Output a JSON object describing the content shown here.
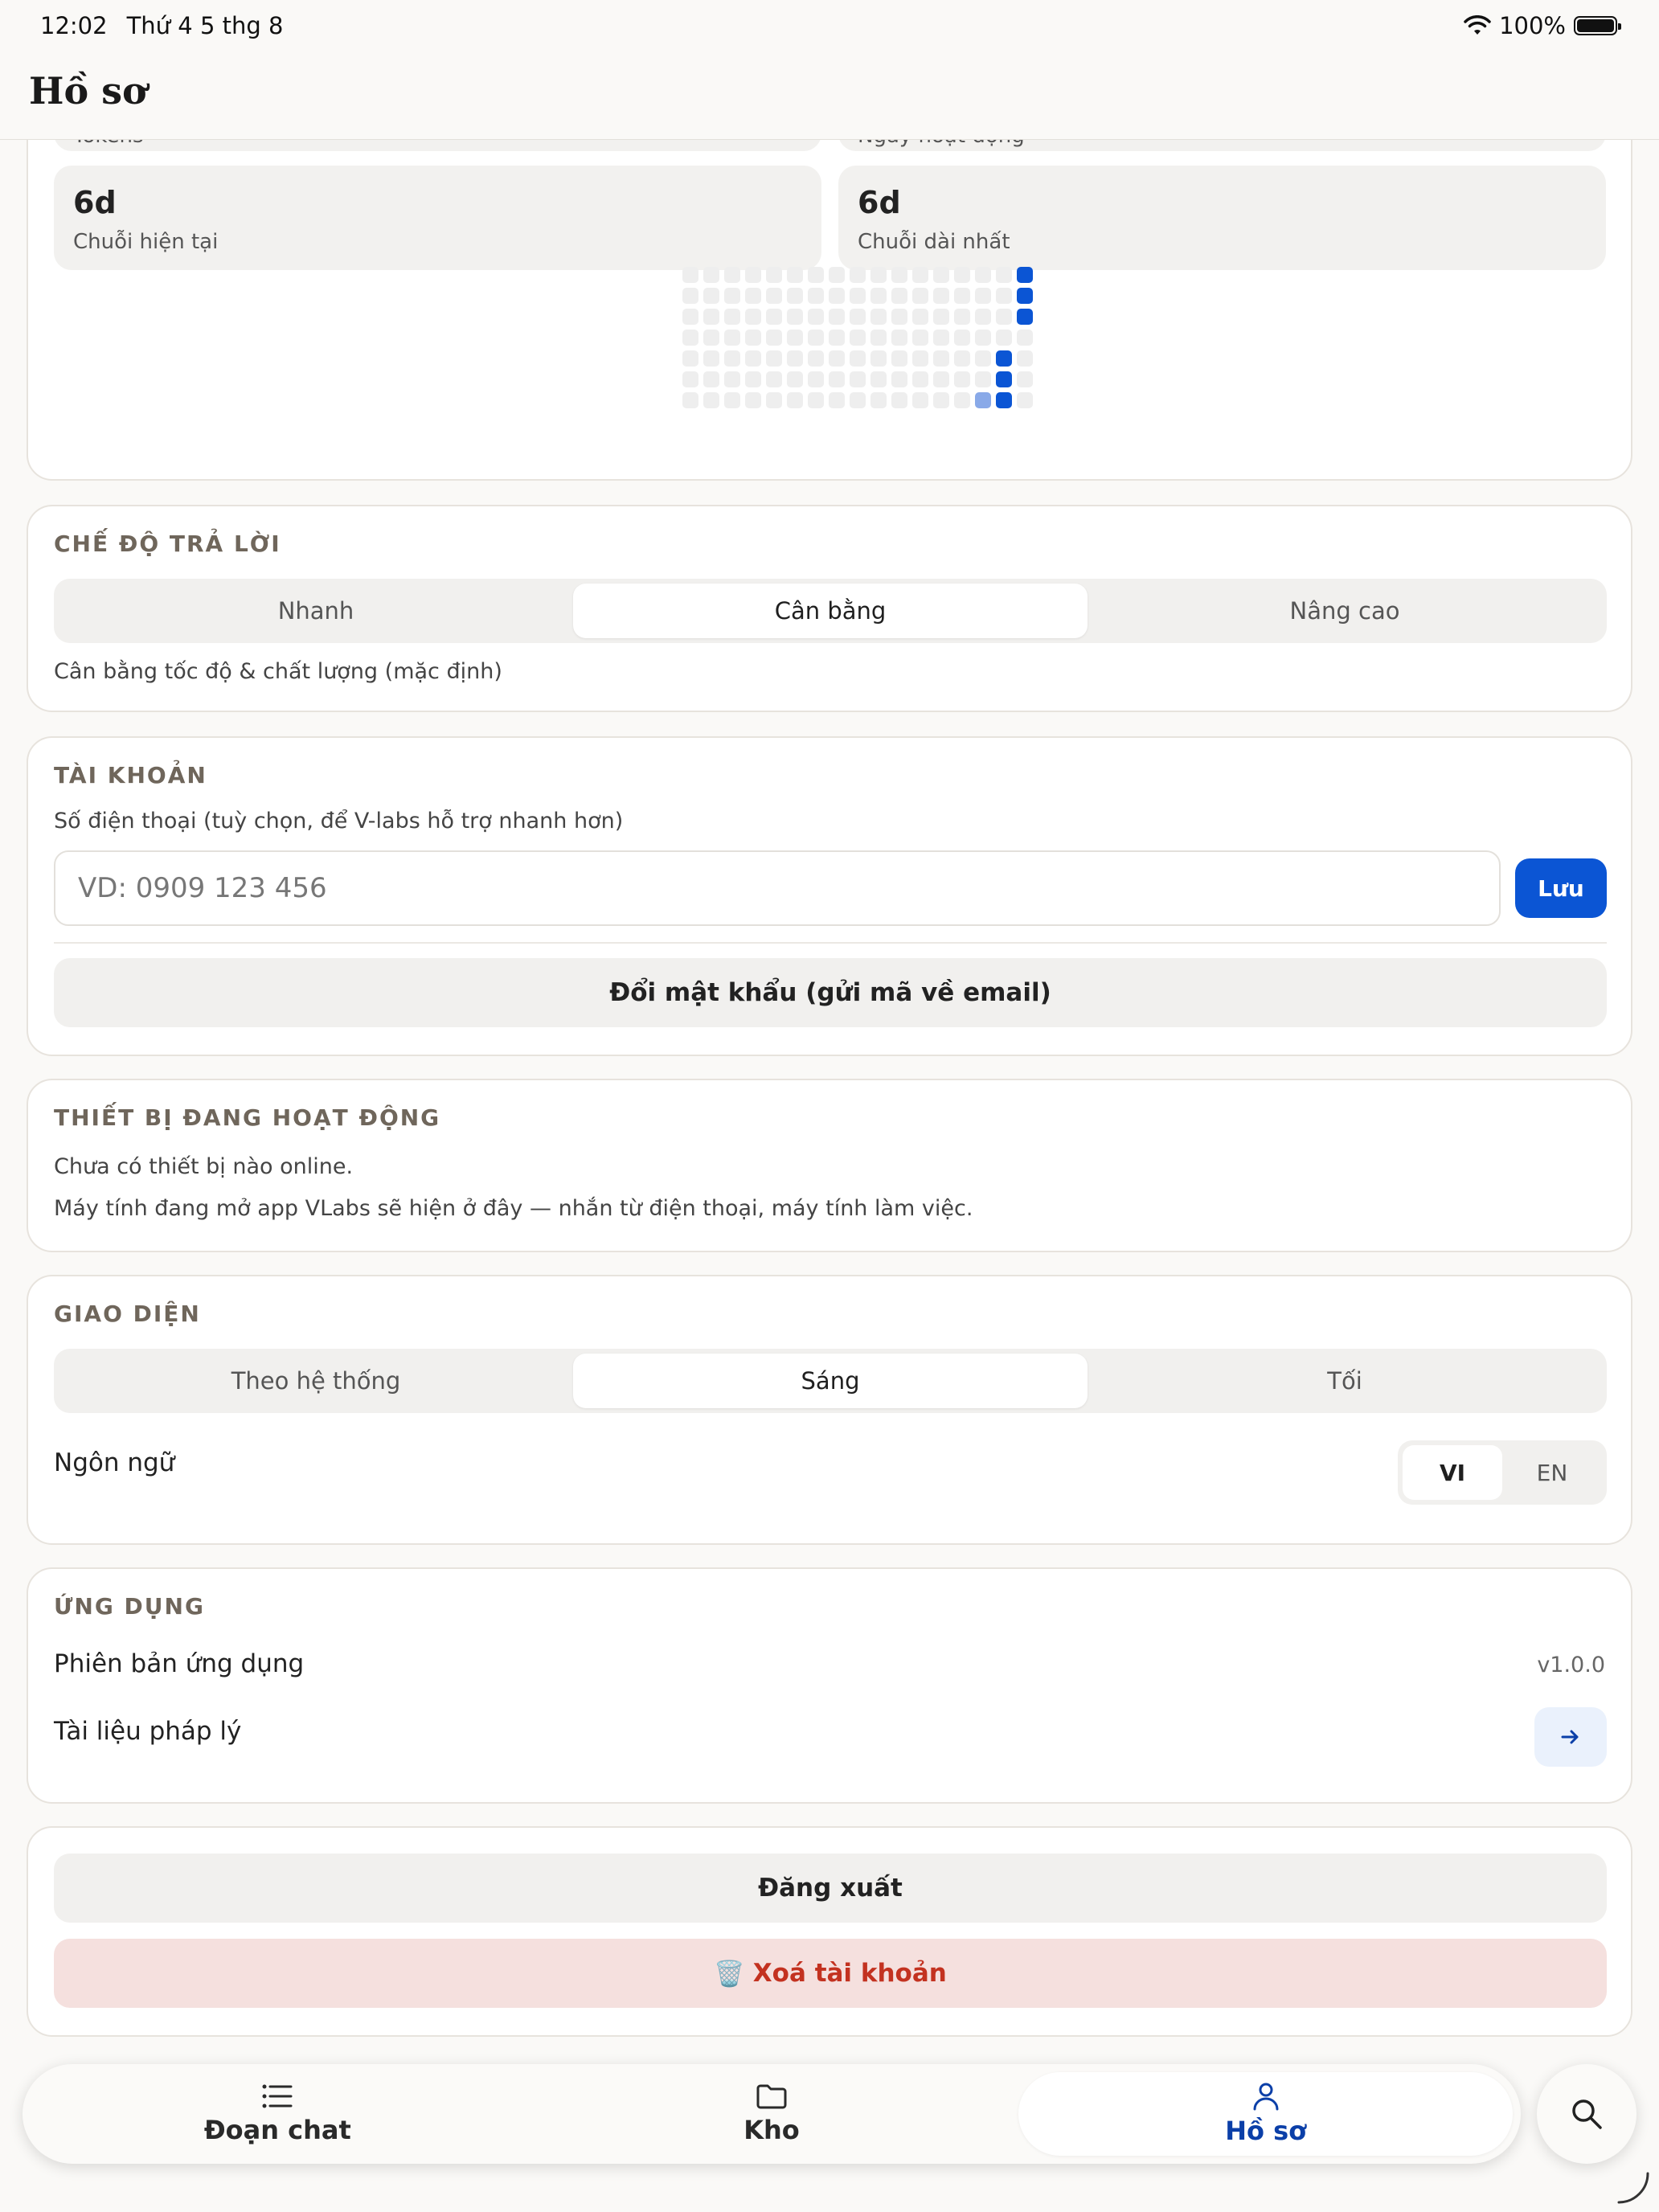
{
  "status": {
    "time": "12:02",
    "date": "Thứ 4 5 thg 8",
    "battery": "100%"
  },
  "header": {
    "title": "Hồ sơ"
  },
  "stats": {
    "top_left_label": "Tokens",
    "top_right_label": "Ngày hoạt động",
    "current_streak_value": "6d",
    "current_streak_label": "Chuỗi hiện tại",
    "longest_streak_value": "6d",
    "longest_streak_label": "Chuỗi dài nhất"
  },
  "response_mode": {
    "title": "CHẾ ĐỘ TRẢ LỜI",
    "options": [
      "Nhanh",
      "Cân bằng",
      "Nâng cao"
    ],
    "selected": "Cân bằng",
    "description": "Cân bằng tốc độ & chất lượng (mặc định)"
  },
  "account": {
    "title": "TÀI KHOẢN",
    "phone_label": "Số điện thoại (tuỳ chọn, để V-labs hỗ trợ nhanh hơn)",
    "phone_placeholder": "VD: 0909 123 456",
    "phone_value": "",
    "save_label": "Lưu",
    "change_password_label": "Đổi mật khẩu (gửi mã về email)"
  },
  "devices": {
    "title": "THIẾT BỊ ĐANG HOẠT ĐỘNG",
    "empty_text": "Chưa có thiết bị nào online.",
    "hint_text": "Máy tính đang mở app VLabs sẽ hiện ở đây — nhắn từ điện thoại, máy tính làm việc."
  },
  "appearance": {
    "title": "GIAO DIỆN",
    "theme_options": [
      "Theo hệ thống",
      "Sáng",
      "Tối"
    ],
    "theme_selected": "Sáng",
    "language_label": "Ngôn ngữ",
    "language_options": [
      "VI",
      "EN"
    ],
    "language_selected": "VI"
  },
  "app": {
    "title": "ỨNG DỤNG",
    "version_label": "Phiên bản ứng dụng",
    "version_value": "v1.0.0",
    "legal_label": "Tài liệu pháp lý"
  },
  "session": {
    "logout_label": "Đăng xuất",
    "delete_account_label": "Xoá tài khoản",
    "delete_icon": "🗑️"
  },
  "tabs": [
    {
      "label": "Đoạn chat",
      "icon": "list-icon"
    },
    {
      "label": "Kho",
      "icon": "folder-icon"
    },
    {
      "label": "Hồ sơ",
      "icon": "person-icon"
    }
  ],
  "active_tab": "Hồ sơ",
  "colors": {
    "accent": "#0b55d4",
    "accent_light": "#89a9e8",
    "danger": "#c33220",
    "danger_bg": "#f5e0de",
    "heatmap_empty": "#eeeeee"
  },
  "heatmap": {
    "columns": 17,
    "rows": 7,
    "active_cells": [
      {
        "col": 16,
        "row": 0,
        "level": "high"
      },
      {
        "col": 16,
        "row": 1,
        "level": "high"
      },
      {
        "col": 16,
        "row": 2,
        "level": "high"
      },
      {
        "col": 15,
        "row": 4,
        "level": "high"
      },
      {
        "col": 15,
        "row": 5,
        "level": "high"
      },
      {
        "col": 15,
        "row": 6,
        "level": "high"
      },
      {
        "col": 14,
        "row": 6,
        "level": "low"
      }
    ]
  }
}
